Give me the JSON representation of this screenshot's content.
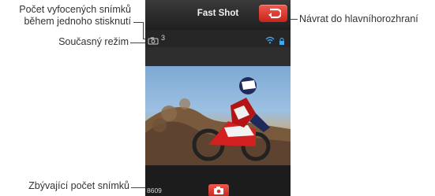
{
  "app": {
    "title": "Fast Shot"
  },
  "status": {
    "shots_per_press": "3"
  },
  "bottom": {
    "remaining_shots": "8609"
  },
  "callouts": {
    "shots_per_press_line1": "Počet vyfocených snímků",
    "shots_per_press_line2": "během jednoho stisknutí",
    "current_mode": "Současný režim",
    "back_to_main": "Návrat do hlavníhorozhraní",
    "remaining_shots": "Zbývající počet snímků"
  },
  "icons": {
    "mode": "multi-shot-camera-icon",
    "wifi": "wifi-icon",
    "lock": "lock-icon",
    "back": "return-arrow-icon",
    "shutter": "camera-icon"
  },
  "colors": {
    "accent_red": "#d9362b",
    "status_blue": "#3fa9f5"
  }
}
